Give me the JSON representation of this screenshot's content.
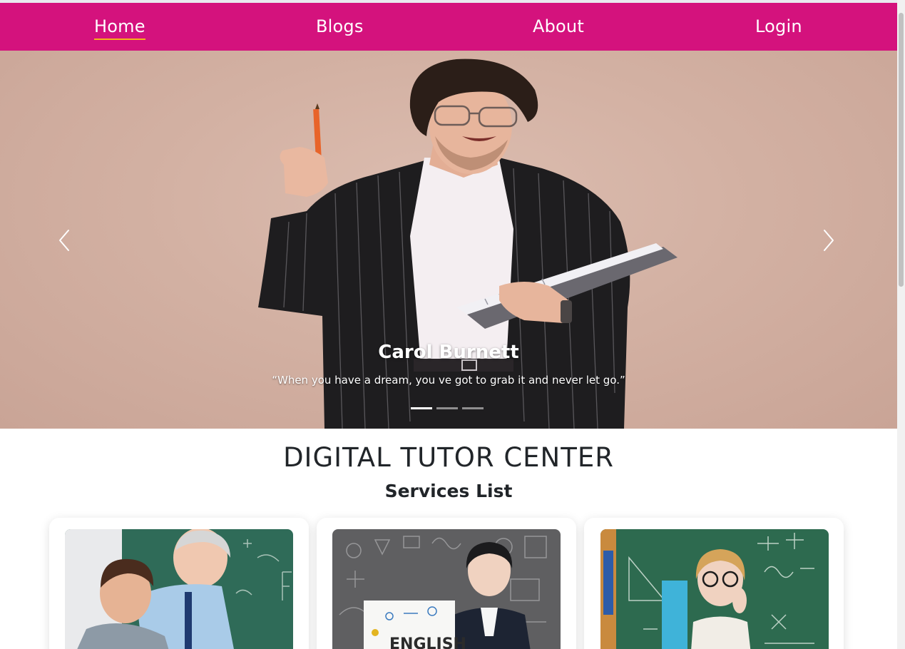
{
  "nav": {
    "items": [
      {
        "label": "Home",
        "active": true
      },
      {
        "label": "Blogs"
      },
      {
        "label": "About"
      },
      {
        "label": "Login"
      }
    ]
  },
  "carousel": {
    "slide_title": "Carol Burnett",
    "slide_quote": "“When you have a dream, you ve got to grab it and never let go.”",
    "prev_icon": "chevron-left-icon",
    "next_icon": "chevron-right-icon",
    "slide_count": 3,
    "active_slide": 1
  },
  "page": {
    "title": "DIGITAL TUTOR CENTER",
    "subtitle": "Services List"
  },
  "services": {
    "cards": [
      {
        "image": "tutor-helping-student-photo"
      },
      {
        "image": "english-teacher-photo"
      },
      {
        "image": "math-teacher-chalkboard-photo"
      }
    ],
    "card2_image_text": "ENGLISH"
  },
  "colors": {
    "navbar": "#d4127d",
    "nav_active_underline": "#f5b21a",
    "carousel_background": "#d3b1a3"
  }
}
